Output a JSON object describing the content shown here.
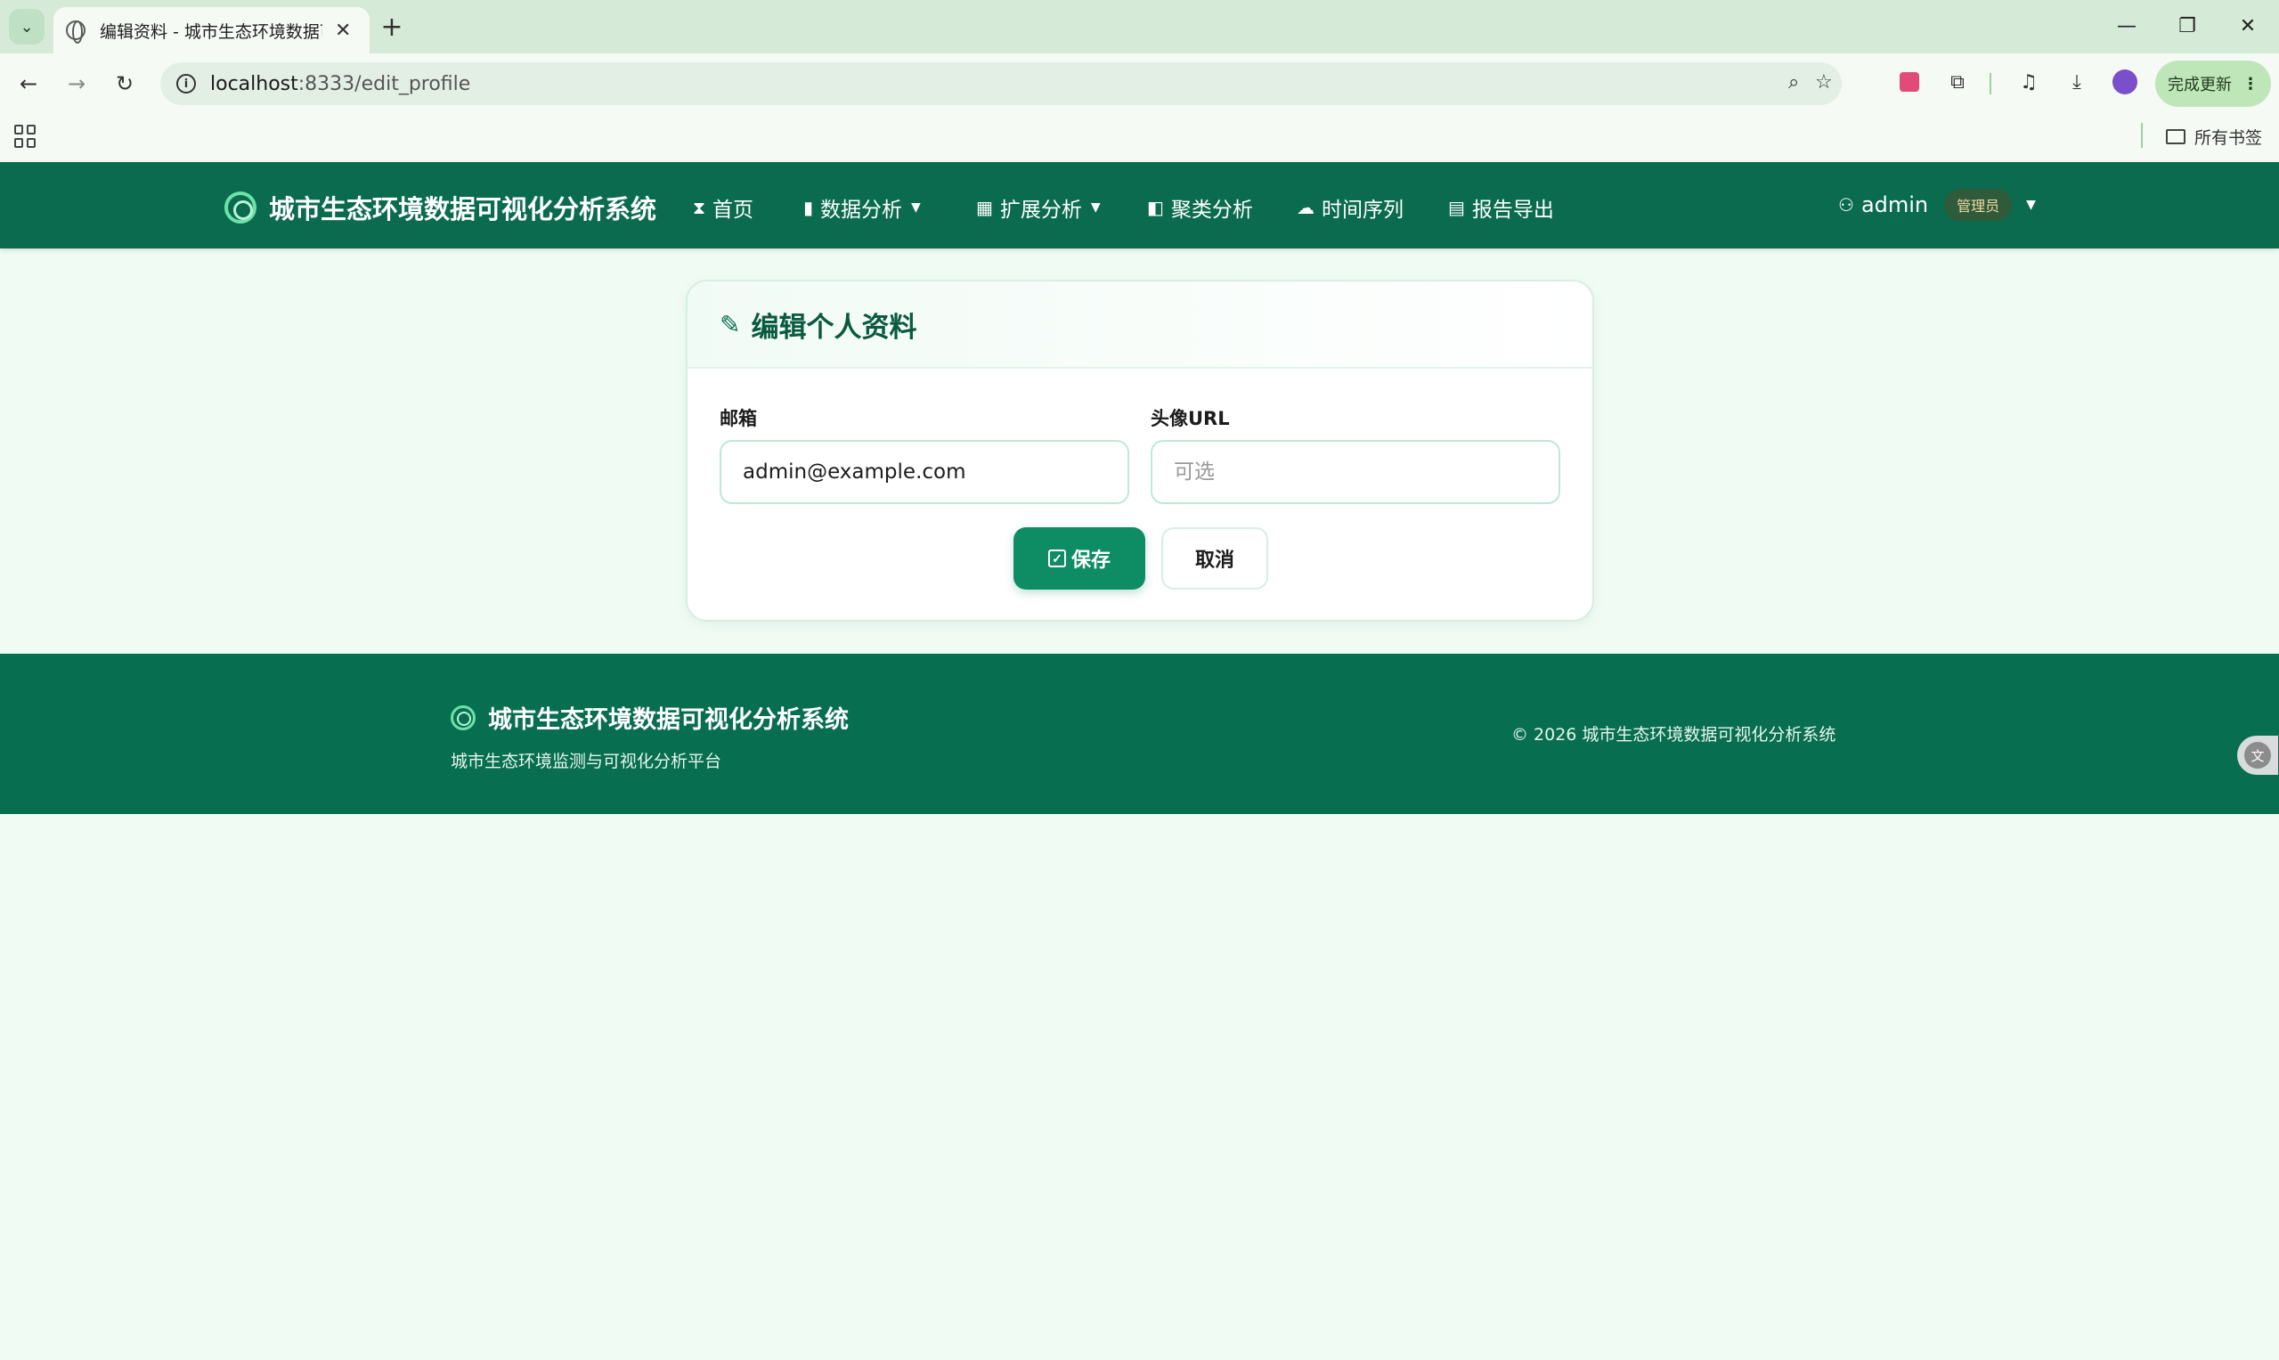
{
  "browser": {
    "tab_title": "编辑资料 - 城市生态环境数据可视化分析系统",
    "tab_close": "✕",
    "new_tab": "+",
    "url_host": "localhost",
    "url_rest": ":8333/edit_profile",
    "update_label": "完成更新",
    "all_bookmarks": "所有书签",
    "window": {
      "minimize": "—",
      "restore": "❐",
      "close": "✕"
    }
  },
  "navbar": {
    "brand": "城市生态环境数据可视化分析系统",
    "links": [
      {
        "label": "首页",
        "icon": "hourglass-icon"
      },
      {
        "label": "数据分析",
        "icon": "bar-chart-icon"
      },
      {
        "label": "扩展分析",
        "icon": "grid-icon"
      },
      {
        "label": "聚类分析",
        "icon": "layout-icon"
      },
      {
        "label": "时间序列",
        "icon": "cloud-icon"
      },
      {
        "label": "报告导出",
        "icon": "report-icon"
      }
    ],
    "user": {
      "name": "admin",
      "role": "管理员"
    }
  },
  "form": {
    "title": "编辑个人资料",
    "email_label": "邮箱",
    "email_value": "admin@example.com",
    "avatar_label": "头像URL",
    "avatar_placeholder": "可选",
    "save_label": "保存",
    "cancel_label": "取消"
  },
  "footer": {
    "brand": "城市生态环境数据可视化分析系统",
    "subtitle": "城市生态环境监测与可视化分析平台",
    "copyright": "© 2026 城市生态环境数据可视化分析系统"
  },
  "colors": {
    "navbar_bg": "#0a6b4e",
    "footer_bg": "#086e50",
    "accent": "#0e8c63",
    "page_bg": "#f0fbf4"
  }
}
